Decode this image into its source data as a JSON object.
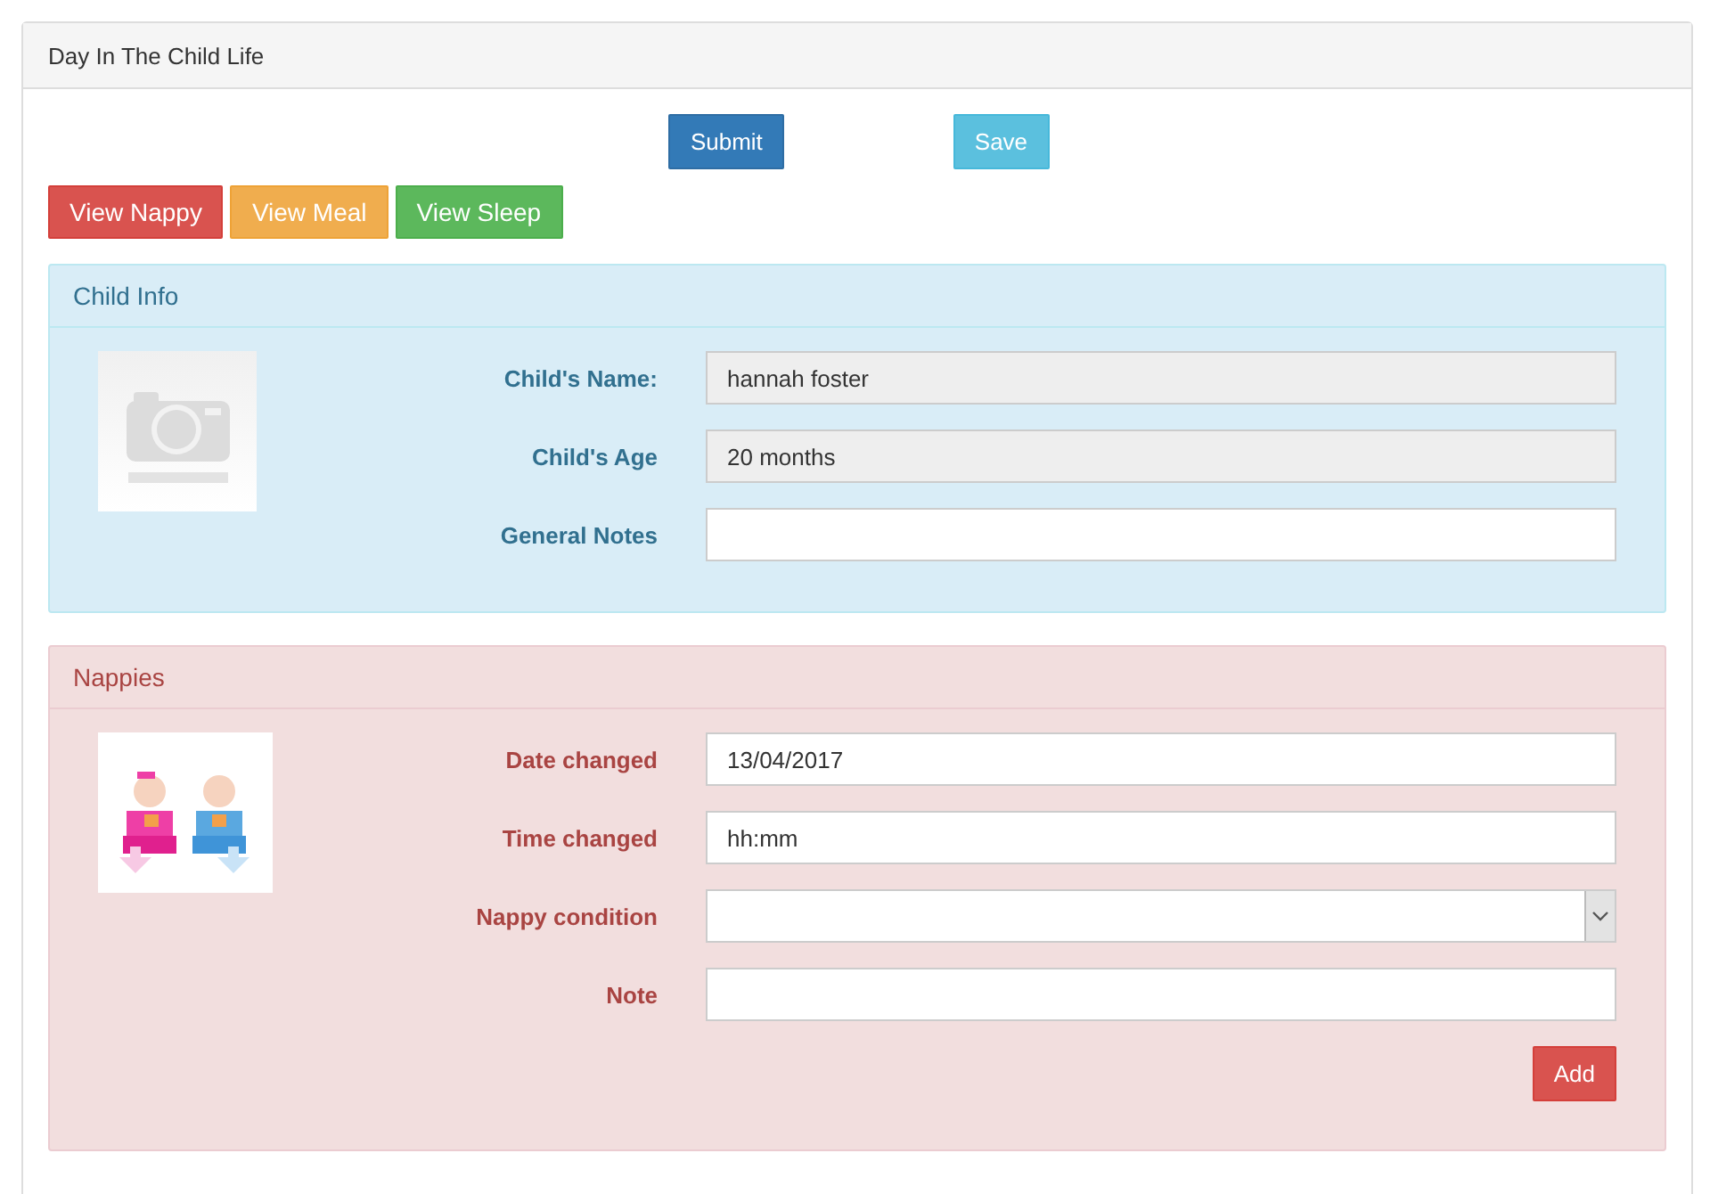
{
  "page_title": "Day In The Child Life",
  "action_buttons": [
    {
      "label": "Submit",
      "kind": "primary"
    },
    {
      "label": "Save",
      "kind": "info"
    }
  ],
  "view_buttons": [
    {
      "label": "View Nappy",
      "kind": "danger"
    },
    {
      "label": "View Meal",
      "kind": "warning"
    },
    {
      "label": "View Sleep",
      "kind": "success"
    }
  ],
  "sections": [
    {
      "title": "Child Info",
      "kind": "info",
      "picture": {
        "kind": "picture"
      },
      "fields": [
        {
          "label": "Child's Name:",
          "kind": "text",
          "value": "hannah foster",
          "disabled": true
        },
        {
          "label": "Child's Age",
          "kind": "text",
          "value": "20 months",
          "disabled": true
        },
        {
          "label": "General Notes",
          "kind": "text",
          "disabled": false
        }
      ]
    },
    {
      "title": "Nappies",
      "kind": "danger",
      "picture": {
        "kind": "picture"
      },
      "fields": [
        {
          "label": "Date changed",
          "kind": "text",
          "value": "13/04/2017",
          "disabled": false
        },
        {
          "label": "Time changed",
          "kind": "text",
          "value": "hh:mm",
          "disabled": false
        },
        {
          "label": "Nappy condition",
          "kind": "select",
          "disabled": false
        },
        {
          "label": "Note",
          "kind": "text",
          "disabled": false
        }
      ],
      "button": {
        "label": "Add",
        "kind": "danger"
      }
    }
  ]
}
